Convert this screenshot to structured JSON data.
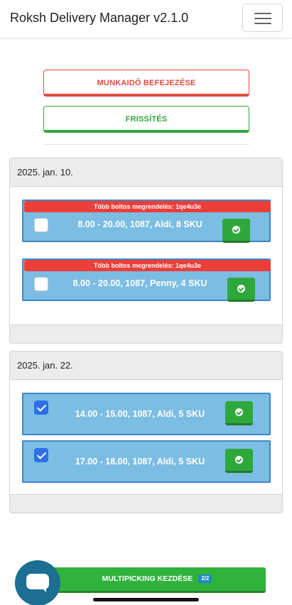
{
  "app": {
    "title": "Roksh Delivery Manager v2.1.0"
  },
  "actions": {
    "end_shift_label": "MUNKAIDŐ BEFEJEZÉSE",
    "refresh_label": "FRISSÍTÉS"
  },
  "groups": [
    {
      "date": "2025. jan. 10.",
      "items": [
        {
          "flag": "Több boltos megrendelés: 1qe4u3e",
          "text": "8.00 - 20.00, 1087, Aldi, 8 SKU",
          "checked": false
        },
        {
          "flag": "Több boltos megrendelés: 1qe4u3e",
          "text": "8.00 - 20.00, 1087, Penny, 4 SKU",
          "checked": false
        }
      ]
    },
    {
      "date": "2025. jan. 22.",
      "items": [
        {
          "flag": "",
          "text": "14.00 - 15.00, 1087, Aldi, 5 SKU",
          "checked": true
        },
        {
          "flag": "",
          "text": "17.00 - 18.00, 1087, Aldi, 5 SKU",
          "checked": true
        }
      ]
    }
  ],
  "footer": {
    "multipicking_label": "MULTIPICKING KEZDÉSE",
    "multipicking_count": "2/2"
  },
  "icons": {
    "menu": "hamburger-icon",
    "confirm": "check-circle-icon",
    "chat": "chat-icon"
  },
  "colors": {
    "danger": "#e4483f",
    "success": "#31a83a",
    "item_bg": "#7cbde3",
    "item_border": "#3d87c9",
    "flag": "#ec3f3a",
    "checkbox_on": "#2c6fe9"
  }
}
